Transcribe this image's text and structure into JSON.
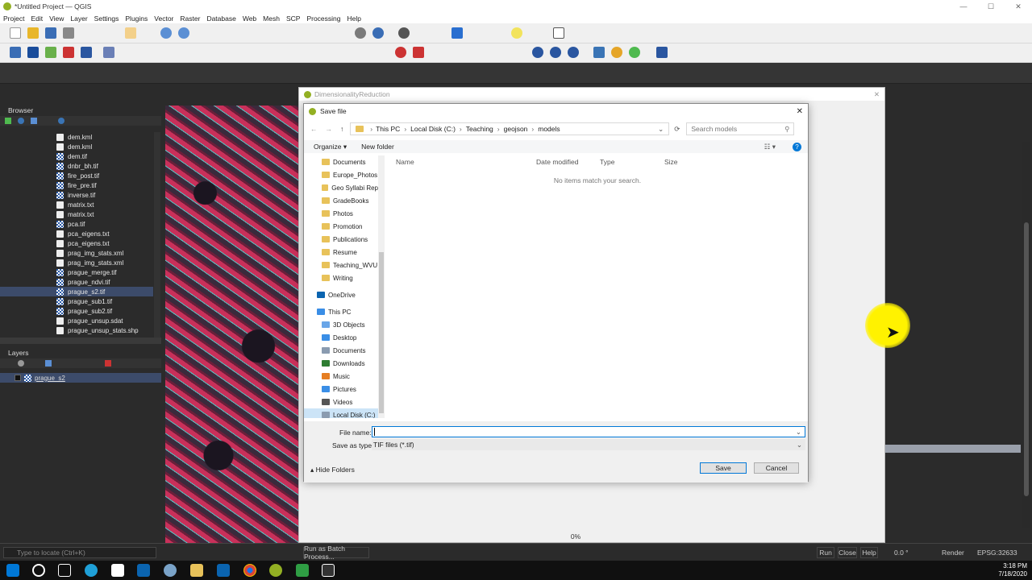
{
  "window": {
    "title": "*Untitled Project — QGIS"
  },
  "menu": [
    "Project",
    "Edit",
    "View",
    "Layer",
    "Settings",
    "Plugins",
    "Vector",
    "Raster",
    "Database",
    "Web",
    "Mesh",
    "SCP",
    "Processing",
    "Help"
  ],
  "browser": {
    "title": "Browser",
    "items": [
      {
        "label": "dem.kml",
        "type": "vec"
      },
      {
        "label": "dem.kml",
        "type": "vec"
      },
      {
        "label": "dem.tif",
        "type": "ras"
      },
      {
        "label": "dnbr_bh.tif",
        "type": "ras"
      },
      {
        "label": "fire_post.tif",
        "type": "ras"
      },
      {
        "label": "fire_pre.tif",
        "type": "ras"
      },
      {
        "label": "inverse.tif",
        "type": "ras"
      },
      {
        "label": "matrix.txt",
        "type": "vec"
      },
      {
        "label": "matrix.txt",
        "type": "vec"
      },
      {
        "label": "pca.tif",
        "type": "ras"
      },
      {
        "label": "pca_eigens.txt",
        "type": "vec"
      },
      {
        "label": "pca_eigens.txt",
        "type": "vec"
      },
      {
        "label": "prag_img_stats.xml",
        "type": "vec"
      },
      {
        "label": "prag_img_stats.xml",
        "type": "vec"
      },
      {
        "label": "prague_merge.tif",
        "type": "ras"
      },
      {
        "label": "prague_ndvi.tif",
        "type": "ras"
      },
      {
        "label": "prague_s2.tif",
        "type": "ras",
        "selected": true
      },
      {
        "label": "prague_sub1.tif",
        "type": "ras"
      },
      {
        "label": "prague_sub2.tif",
        "type": "ras"
      },
      {
        "label": "prague_unsup.sdat",
        "type": "vec"
      },
      {
        "label": "prague_unsup_stats.shp",
        "type": "vec"
      }
    ]
  },
  "layers": {
    "title": "Layers",
    "items": [
      "prague_s2"
    ]
  },
  "processing_dialog": {
    "title": "DimensionalityReduction",
    "progress": "0%",
    "batch_button": "Run as Batch Process...",
    "run_button": "Run",
    "close_button": "Close",
    "help_button": "Help"
  },
  "save_dialog": {
    "title": "Save file",
    "breadcrumb": [
      "This PC",
      "Local Disk (C:)",
      "Teaching",
      "geojson",
      "models"
    ],
    "search_placeholder": "Search models",
    "organize_label": "Organize",
    "new_folder_label": "New folder",
    "columns": [
      "Name",
      "Date modified",
      "Type",
      "Size"
    ],
    "empty_message": "No items match your search.",
    "nav_quick": [
      "Documents",
      "Europe_Photos",
      "Geo Syllabi Rep",
      "GradeBooks",
      "Photos",
      "Promotion",
      "Publications",
      "Resume",
      "Teaching_WVU",
      "Writing"
    ],
    "nav_onedrive": "OneDrive",
    "nav_thispc": "This PC",
    "nav_pc_items": [
      "3D Objects",
      "Desktop",
      "Documents",
      "Downloads",
      "Music",
      "Pictures",
      "Videos",
      "Local Disk (C:)"
    ],
    "file_name_label": "File name:",
    "file_name_value": "",
    "save_as_type_label": "Save as type:",
    "save_as_type_value": "TIF files (*.tif)",
    "hide_folders_label": "Hide Folders",
    "save_button": "Save",
    "cancel_button": "Cancel"
  },
  "statusbar": {
    "locate_placeholder": "Type to locate (Ctrl+K)",
    "rotation": "0.0 °",
    "render_label": "Render",
    "crs": "EPSG:32633"
  },
  "clock": {
    "time": "3:18 PM",
    "date": "7/18/2020"
  },
  "colors": {
    "qgis_green": "#93b023",
    "selection": "#3c4b6a",
    "save_accent": "#0078d7"
  }
}
